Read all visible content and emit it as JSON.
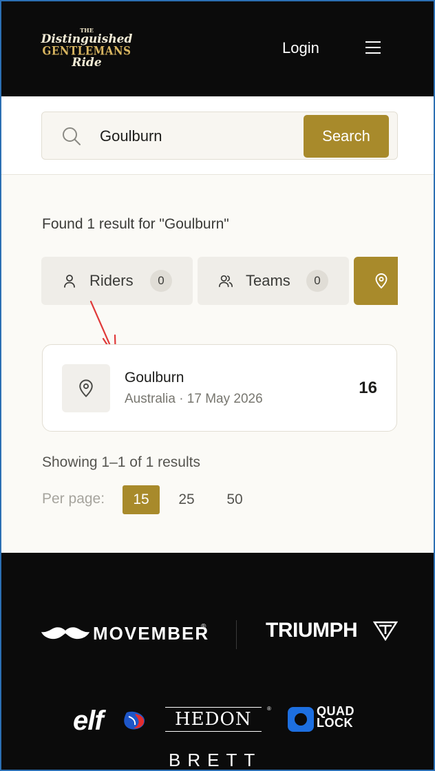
{
  "header": {
    "logo": {
      "line1": "THE",
      "line2": "Distinguished",
      "line3": "GENTLEMANS",
      "line4": "Ride"
    },
    "login_label": "Login",
    "menu_icon": "hamburger-icon"
  },
  "search": {
    "query": "Goulburn",
    "button_label": "Search",
    "icon": "search-icon"
  },
  "results": {
    "found_text": "Found 1 result for \"Goulburn\"",
    "tabs": [
      {
        "label": "Riders",
        "count": "0",
        "icon": "user-icon"
      },
      {
        "label": "Teams",
        "count": "0",
        "icon": "users-icon"
      },
      {
        "label": "",
        "icon": "map-pin-icon",
        "active": true
      }
    ],
    "items": [
      {
        "title": "Goulburn",
        "subtitle": "Australia · 17 May 2026",
        "count": "16",
        "icon": "map-pin-icon"
      }
    ],
    "showing_text": "Showing 1–1 of 1 results",
    "per_page": {
      "label": "Per page:",
      "options": [
        "15",
        "25",
        "50"
      ],
      "selected": "15"
    }
  },
  "footer": {
    "sponsors": {
      "movember": "MOVEMBER",
      "movember_reg": "®",
      "triumph": "TRIUMPH",
      "elf": "elf",
      "hedon": "HEDON",
      "hedon_reg": "®",
      "quad_lock_line1": "QUAD",
      "quad_lock_line2": "LOCK",
      "brett": "BRETT"
    }
  },
  "colors": {
    "accent": "#a88a2b",
    "header_bg": "#0b0b0b",
    "page_bg": "#fbfaf6",
    "annotation_arrow": "#e03a3a"
  }
}
